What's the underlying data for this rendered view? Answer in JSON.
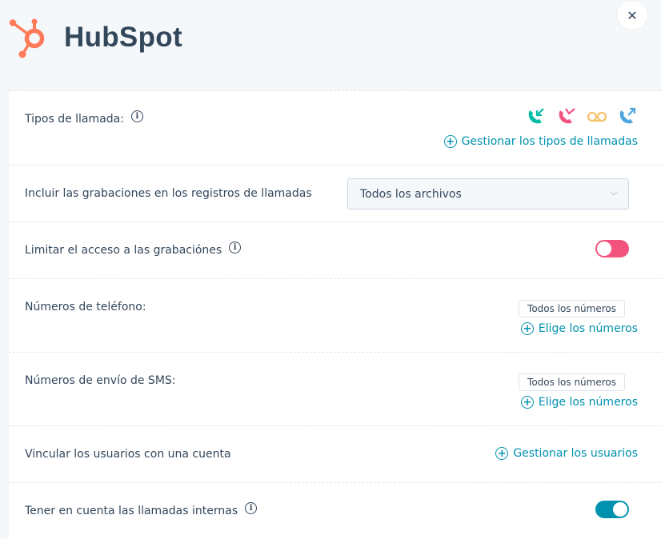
{
  "brand": {
    "name": "HubSpot",
    "accent": "#ff7a59"
  },
  "header": {
    "close_icon": "✕"
  },
  "settings": {
    "call_types": {
      "label": "Tipos de llamada:",
      "icons": [
        "inbound-call-icon",
        "missed-call-icon",
        "voicemail-icon",
        "outbound-call-icon"
      ],
      "manage_link": "Gestionar los tipos de llamadas"
    },
    "recordings": {
      "label": "Incluir las grabaciones en los registros de llamadas",
      "selected": "Todos los archivos"
    },
    "restrict_access": {
      "label": "Limitar el acceso a las grabaciónes",
      "enabled": false
    },
    "phone_numbers": {
      "label": "Números de teléfono:",
      "tag": "Todos los números",
      "link": "Elige los números"
    },
    "sms_numbers": {
      "label": "Números de envío de SMS:",
      "tag": "Todos los números",
      "link": "Elige los números"
    },
    "link_users": {
      "label": "Vincular los usuarios con una cuenta",
      "link": "Gestionar los usuarios"
    },
    "internal_calls": {
      "label": "Tener en cuenta las llamadas internas",
      "enabled": true
    }
  },
  "colors": {
    "link": "#0091ae",
    "toggle_on": "#0091ae",
    "toggle_off": "#f2547d",
    "inbound": "#00bda5",
    "missed": "#f2547d",
    "voicemail": "#f5c26b",
    "outbound": "#4fa6de"
  }
}
